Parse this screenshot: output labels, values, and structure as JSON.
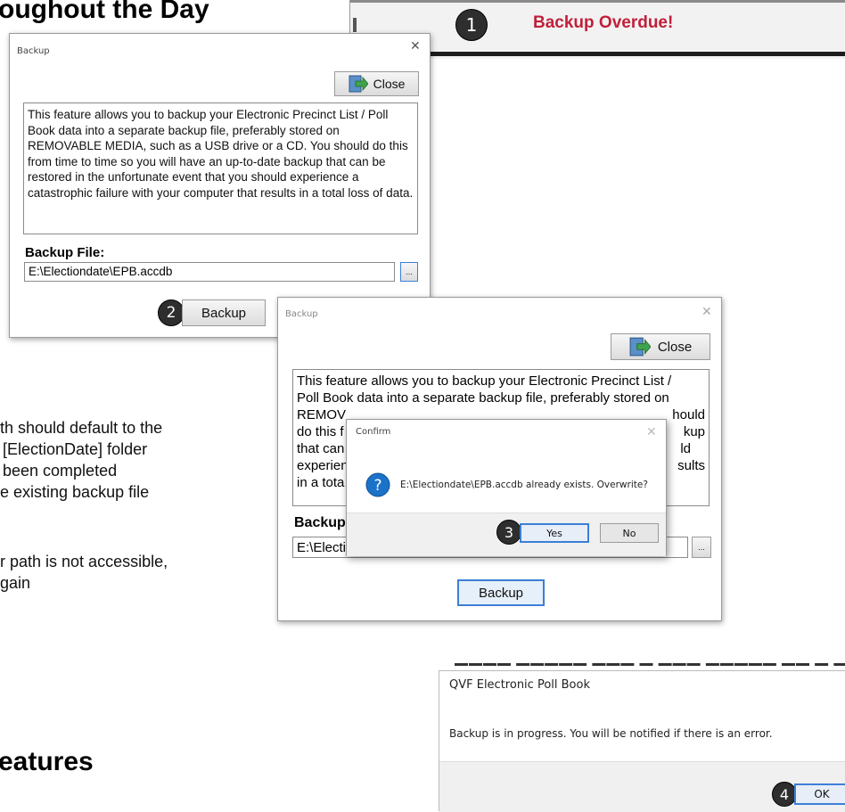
{
  "slide": {
    "heading_top": "oughout the Day",
    "heading_bottom": "eatures",
    "body_lines": [
      "th should default to the",
      "[ElectionDate] folder",
      "been completed",
      "e existing backup file"
    ],
    "body_lines_2": [
      "r path is not accessible,",
      "gain"
    ]
  },
  "banner": {
    "step": "1",
    "text": "Backup Overdue!"
  },
  "backup_dialog_1": {
    "title": "Backup",
    "close_label": "Close",
    "description": "This feature allows you to backup your Electronic Precinct List / Poll Book data into a separate backup file, preferably stored on REMOVABLE MEDIA, such as a USB drive or a CD. You should do this from time to time so you will have an up-to-date backup that can be restored in the unfortunate event that you should experience a catastrophic failure with your computer that results in a total loss of data.",
    "file_label": "Backup File:",
    "file_value": "E:\\Electiondate\\EPB.accdb",
    "browse_label": "...",
    "backup_label": "Backup",
    "step": "2"
  },
  "backup_dialog_2": {
    "title": "Backup",
    "close_label": "Close",
    "desc_lines": [
      "This feature allows you to backup your Electronic Precinct List /",
      "Poll Book data into a separate backup file, preferably stored on",
      "REMOV",
      "do this f",
      "that can",
      "experien",
      "in a tota"
    ],
    "desc_right": [
      "hould",
      "kup",
      "ld",
      "sults"
    ],
    "file_label": "Backup",
    "file_value": "E:\\Electi",
    "browse_label": "...",
    "backup_label": "Backup"
  },
  "confirm_dialog": {
    "title": "Confirm",
    "message": "E:\\Electiondate\\EPB.accdb already exists. Overwrite?",
    "yes_label": "Yes",
    "no_label": "No",
    "step": "3"
  },
  "info_dialog": {
    "title": "QVF Electronic Poll Book",
    "message": "Backup is in progress. You will be notified if there is an error.",
    "ok_label": "OK",
    "step": "4"
  },
  "colors": {
    "banner_text": "#c0203a",
    "focus_blue": "#3c7fd6",
    "question_icon": "#1a73c8"
  },
  "icons": {
    "close": "green-door-arrow-icon",
    "question": "question-mark-icon"
  }
}
